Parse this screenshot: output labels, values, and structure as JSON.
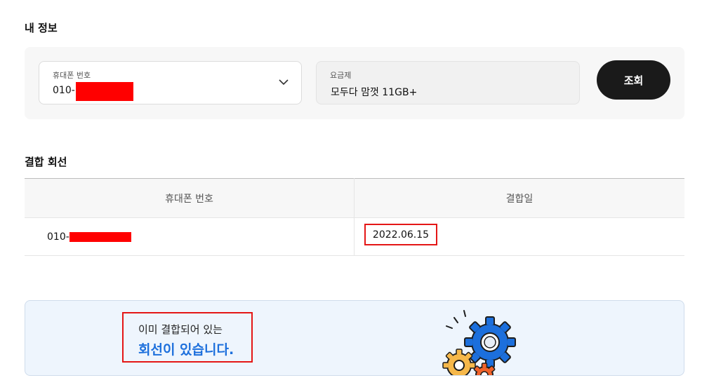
{
  "my_info": {
    "title": "내 정보",
    "phone_label": "휴대폰 번호",
    "phone_value": "010-",
    "plan_label": "요금제",
    "plan_value": "모두다 맘껏 11GB+",
    "search_button": "조회"
  },
  "combined_lines": {
    "title": "결합 회선",
    "columns": [
      "휴대폰 번호",
      "결합일"
    ],
    "rows": [
      {
        "phone": "010-",
        "date": "2022.06.15"
      }
    ]
  },
  "banner": {
    "line1": "이미 결합되어 있는",
    "line2": "회선이 있습니다."
  },
  "colors": {
    "accent_blue": "#1c6fdc",
    "highlight_red": "#e41616",
    "redaction": "#ff0000",
    "button_dark": "#1a1a1a"
  },
  "icons": [
    "chevron-down-icon",
    "gears-illustration"
  ]
}
